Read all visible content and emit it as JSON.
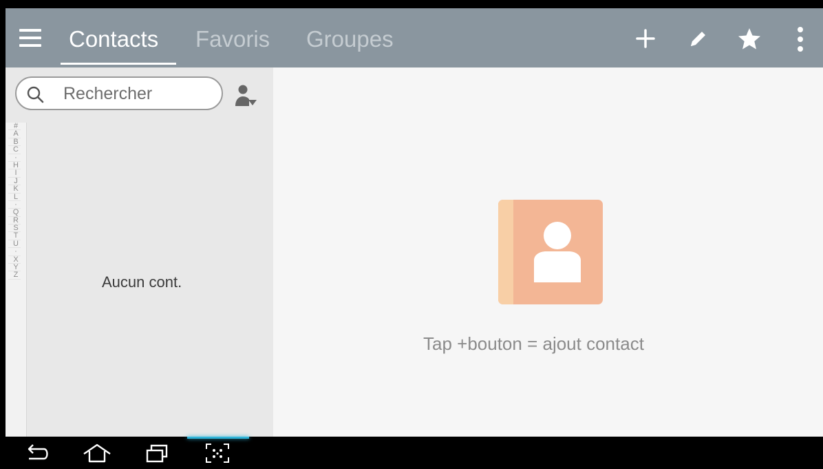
{
  "app_bar": {
    "tabs": [
      {
        "label": "Contacts",
        "active": true
      },
      {
        "label": "Favoris",
        "active": false
      },
      {
        "label": "Groupes",
        "active": false
      }
    ],
    "actions": [
      "add-icon",
      "edit-pencil-icon",
      "star-icon",
      "overflow-menu-icon"
    ],
    "background": "#8a969f"
  },
  "left_panel": {
    "search": {
      "placeholder": "Rechercher",
      "value": ""
    },
    "index": [
      "#",
      "A",
      "B",
      "C",
      "·",
      "H",
      "I",
      "J",
      "K",
      "L",
      "·",
      "Q",
      "R",
      "S",
      "T",
      "U",
      "·",
      "X",
      "Y",
      "Z"
    ],
    "empty_text": "Aucun cont."
  },
  "right_panel": {
    "empty_text": "Tap +bouton = ajout contact",
    "illustration_colors": {
      "cover": "#f3b695",
      "spine": "#f8cfa6",
      "figure": "#ffffff"
    }
  },
  "nav_bar": {
    "buttons": [
      "back-icon",
      "home-icon",
      "recent-apps-icon",
      "screen-capture-icon"
    ],
    "accent": "#2fb4d9"
  }
}
